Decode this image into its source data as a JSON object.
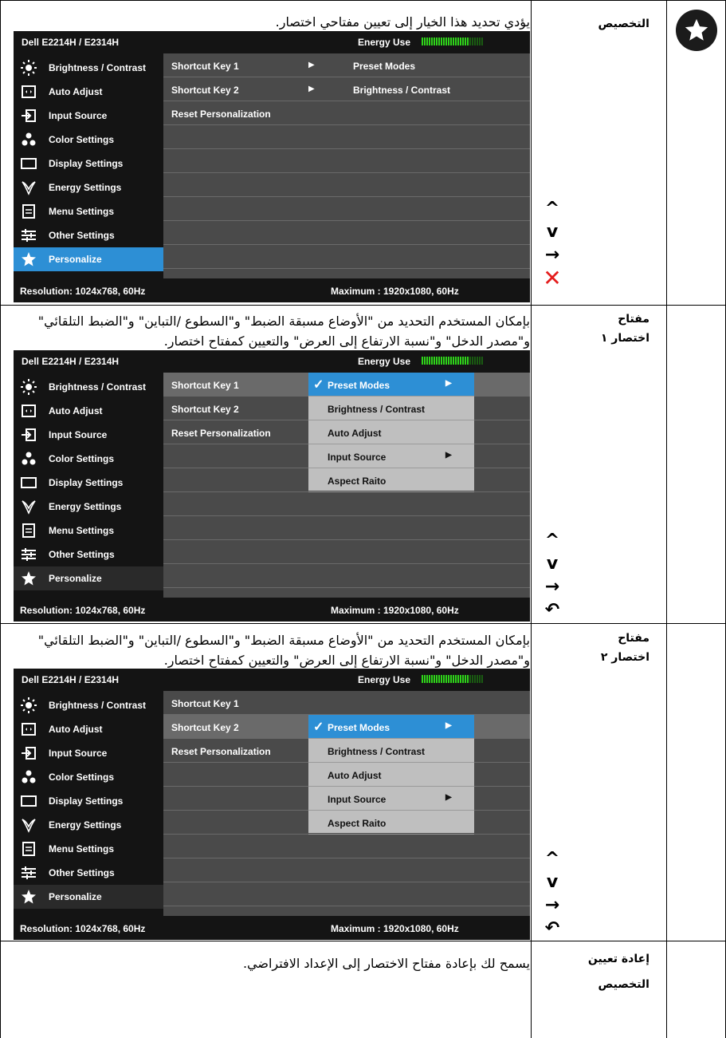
{
  "rows": [
    {
      "label": "التخصيص",
      "desc": "يؤدي تحديد هذا الخيار إلى تعيين مفتاحي اختصار.",
      "icon": "star-icon"
    },
    {
      "label": "مفتاح اختصار ١",
      "desc": "بإمكان المستخدم التحديد من \"الأوضاع مسبقة الضبط\" و\"السطوع /التباين\" و\"الضبط التلقائي\" و\"مصدر الدخل\" و\"نسبة الارتفاع إلى العرض\" والتعيين كمفتاح اختصار."
    },
    {
      "label": "مفتاح اختصار ٢",
      "desc": "بإمكان المستخدم التحديد من \"الأوضاع مسبقة الضبط\" و\"السطوع /التباين\" و\"الضبط التلقائي\" و\"مصدر الدخل\" و\"نسبة الارتفاع إلى العرض\" والتعيين كمفتاح اختصار."
    },
    {
      "label": "إعادة تعيين التخصيص",
      "desc": "يسمح لك بإعادة مفتاح الاختصار إلى الإعداد الافتراضي."
    }
  ],
  "osd": {
    "model": "Dell E2214H / E2314H",
    "energy_label": "Energy Use",
    "resolution": "Resolution: 1024x768,  60Hz",
    "maximum": "Maximum : 1920x1080,  60Hz",
    "menu": [
      {
        "label": "Brightness / Contrast",
        "icon": "brightness-icon"
      },
      {
        "label": "Auto Adjust",
        "icon": "auto-adjust-icon"
      },
      {
        "label": "Input Source",
        "icon": "input-source-icon"
      },
      {
        "label": "Color Settings",
        "icon": "color-settings-icon"
      },
      {
        "label": "Display Settings",
        "icon": "display-settings-icon"
      },
      {
        "label": "Energy Settings",
        "icon": "energy-settings-icon"
      },
      {
        "label": "Menu Settings",
        "icon": "menu-settings-icon"
      },
      {
        "label": "Other Settings",
        "icon": "other-settings-icon"
      },
      {
        "label": "Personalize",
        "icon": "star-icon"
      }
    ],
    "keys": [
      "Shortcut Key 1",
      "Shortcut Key 2",
      "Reset Personalization"
    ],
    "key1_value": "Preset Modes",
    "key2_value": "Brightness / Contrast",
    "options": [
      "Preset Modes",
      "Brightness / Contrast",
      "Auto Adjust",
      "Input Source",
      "Aspect Raito"
    ]
  },
  "nav": {
    "up": "^",
    "down": "v",
    "enter": "→",
    "exit": "✕",
    "back": "↶"
  }
}
